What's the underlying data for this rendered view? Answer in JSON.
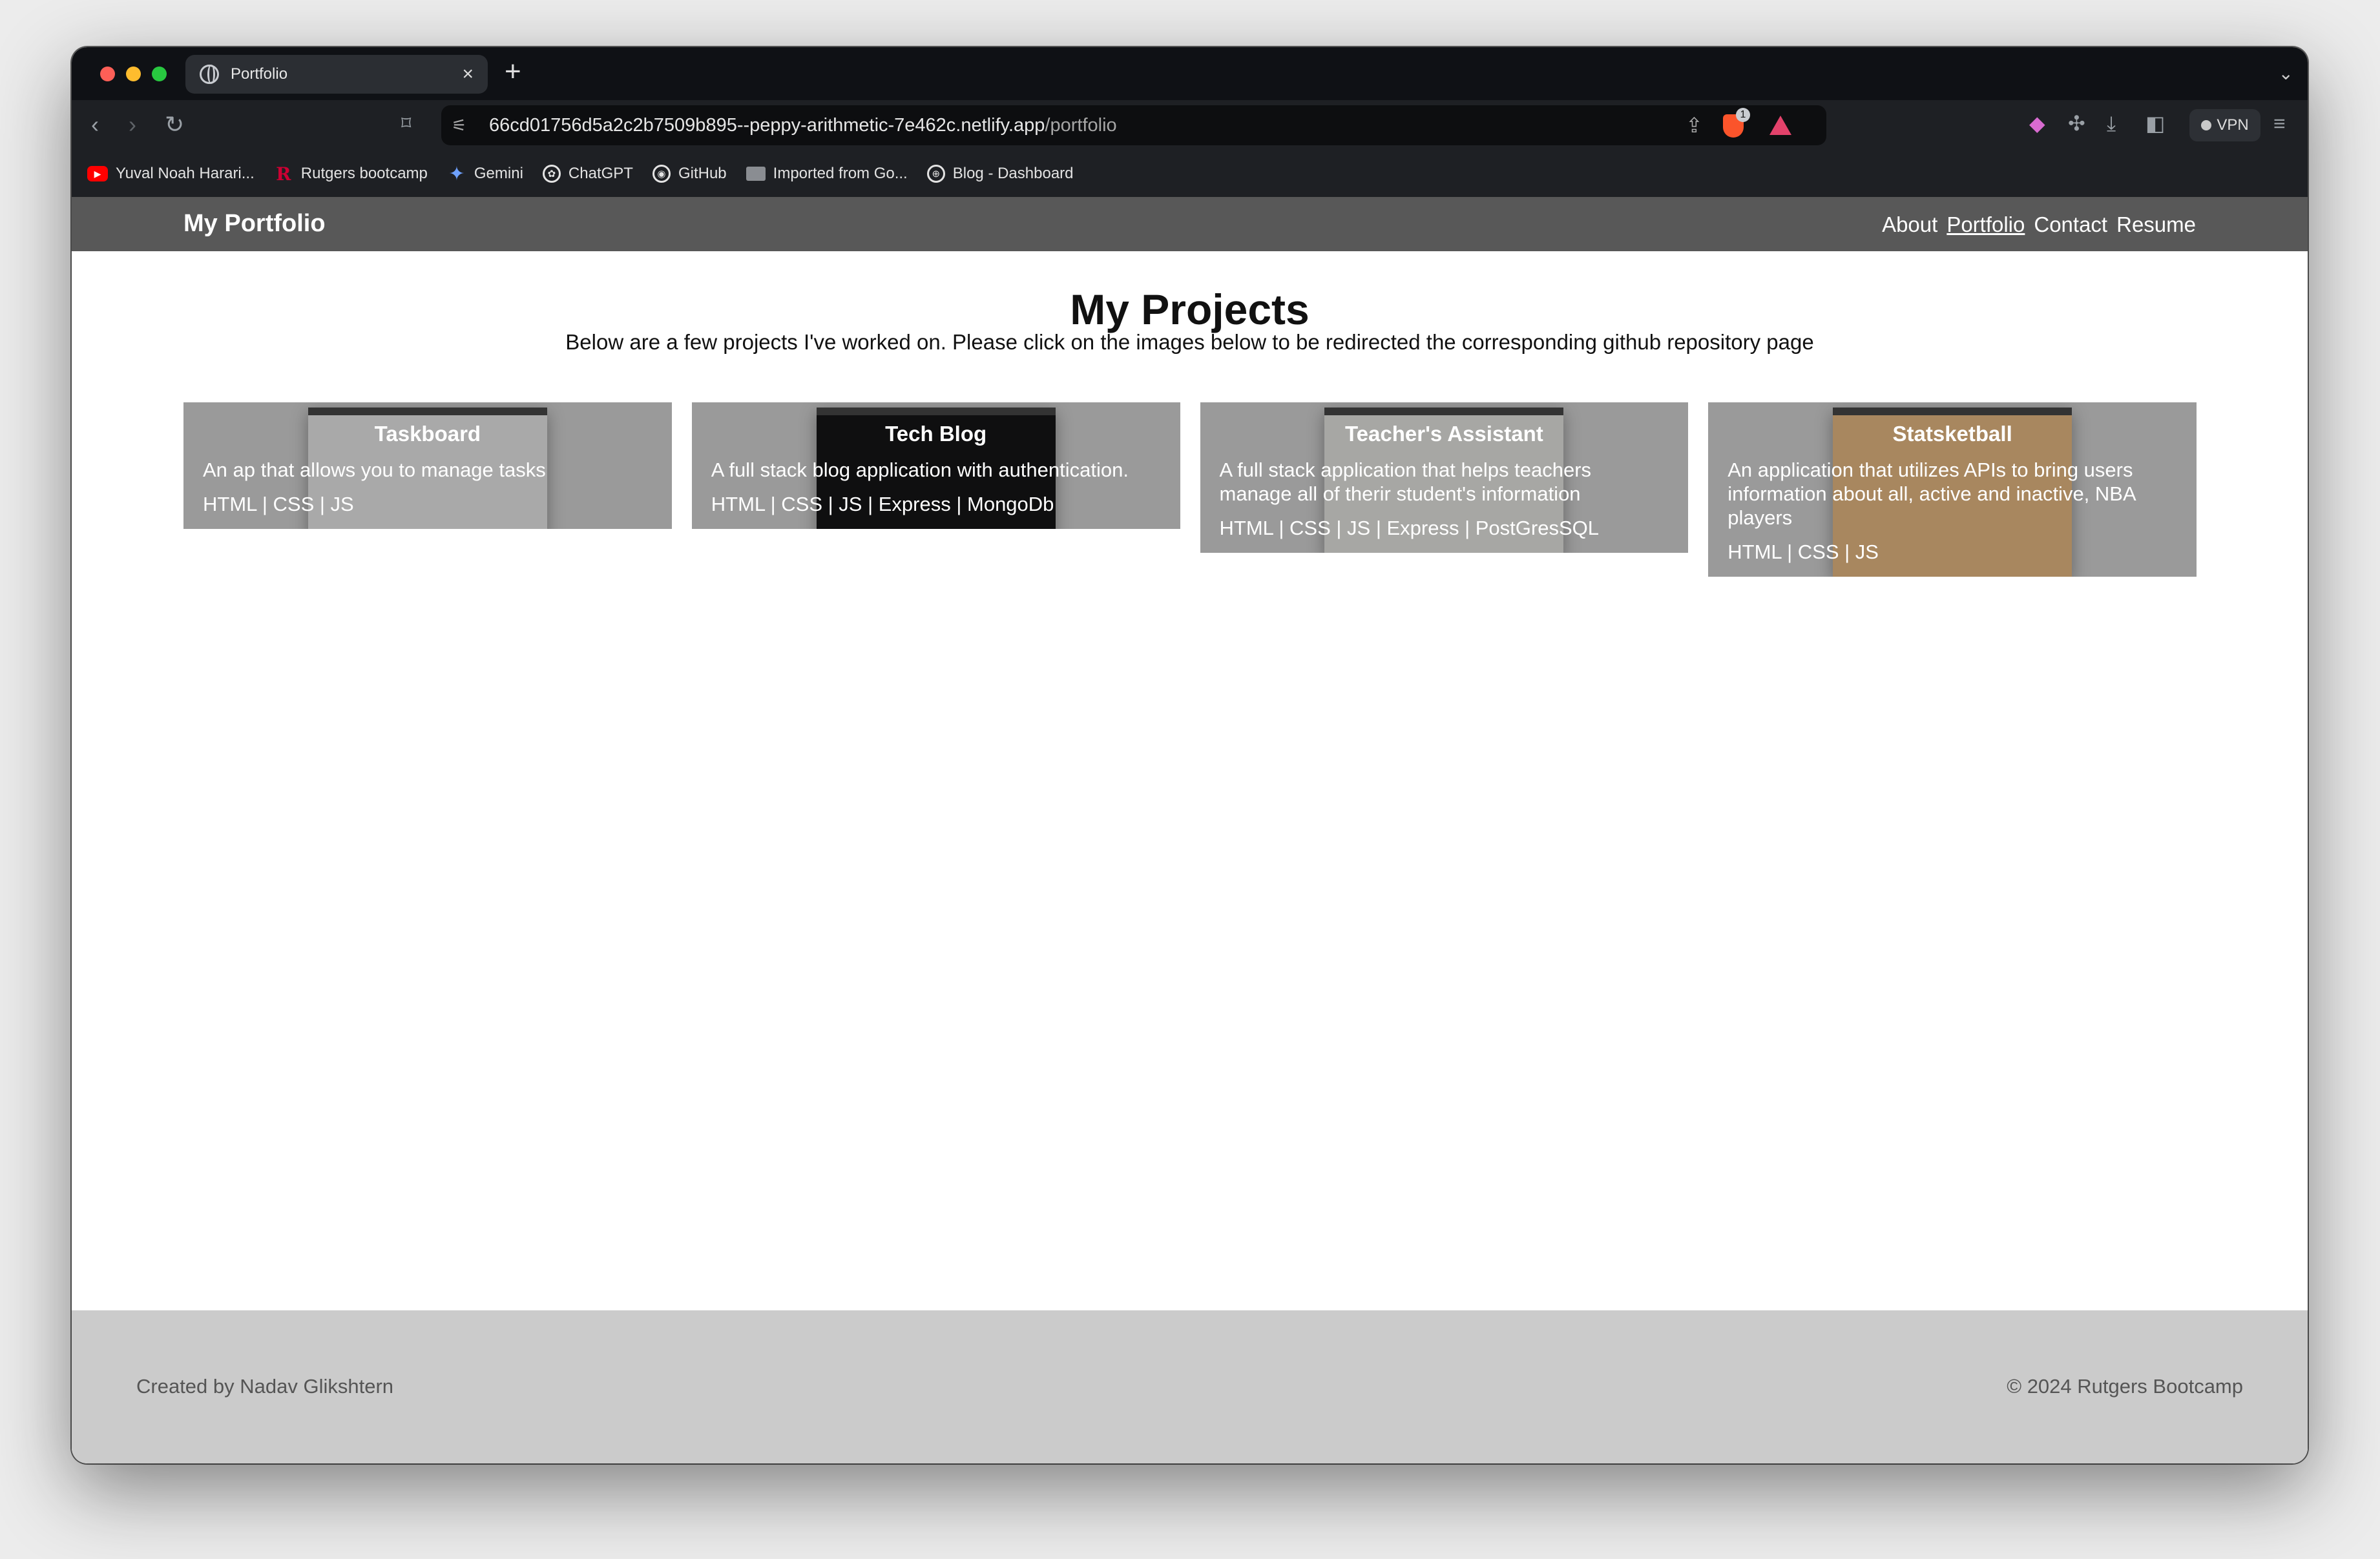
{
  "browser": {
    "tab_title": "Portfolio",
    "tab_close": "×",
    "new_tab": "+",
    "url_host": "66cd01756d5a2c2b7509b895--peppy-arithmetic-7e462c.netlify.app",
    "url_path": "/portfolio",
    "shield_count": "1",
    "vpn_label": "VPN",
    "bookmarks": [
      {
        "label": "Yuval Noah Harari...",
        "icon": "youtube-icon"
      },
      {
        "label": "Rutgers bootcamp",
        "icon": "rutgers-icon"
      },
      {
        "label": "Gemini",
        "icon": "gemini-icon"
      },
      {
        "label": "ChatGPT",
        "icon": "chatgpt-icon"
      },
      {
        "label": "GitHub",
        "icon": "github-icon"
      },
      {
        "label": "Imported from Go...",
        "icon": "folder-icon"
      },
      {
        "label": "Blog - Dashboard",
        "icon": "globe-icon"
      }
    ]
  },
  "site": {
    "brand": "My Portfolio",
    "nav": [
      "About",
      "Portfolio",
      "Contact",
      "Resume"
    ],
    "active_nav": "Portfolio",
    "title": "My Projects",
    "subtitle": "Below are a few projects I've worked on. Please click on the images below to be redirected the corresponding github repository page",
    "projects": [
      {
        "title": "Taskboard",
        "description": "An ap that allows you to manage tasks",
        "tech": "HTML | CSS | JS"
      },
      {
        "title": "Tech Blog",
        "description": "A full stack blog application with authentication.",
        "tech": "HTML | CSS | JS | Express | MongoDb"
      },
      {
        "title": "Teacher's Assistant",
        "description": "A full stack application that helps teachers manage all of therir student's information",
        "tech": "HTML | CSS | JS | Express | PostGresSQL"
      },
      {
        "title": "Statsketball",
        "description": "An application that utilizes APIs to bring users information about all, active and inactive, NBA players",
        "tech": "HTML | CSS | JS"
      }
    ],
    "footer_left": "Created by Nadav Glikshtern",
    "footer_right": "© 2024 Rutgers Bootcamp"
  },
  "colors": {
    "header_bg": "#585858",
    "card_bg": "#9a9a9a",
    "footer_bg": "#cbcbcb",
    "browser_chrome": "#1e2024"
  }
}
